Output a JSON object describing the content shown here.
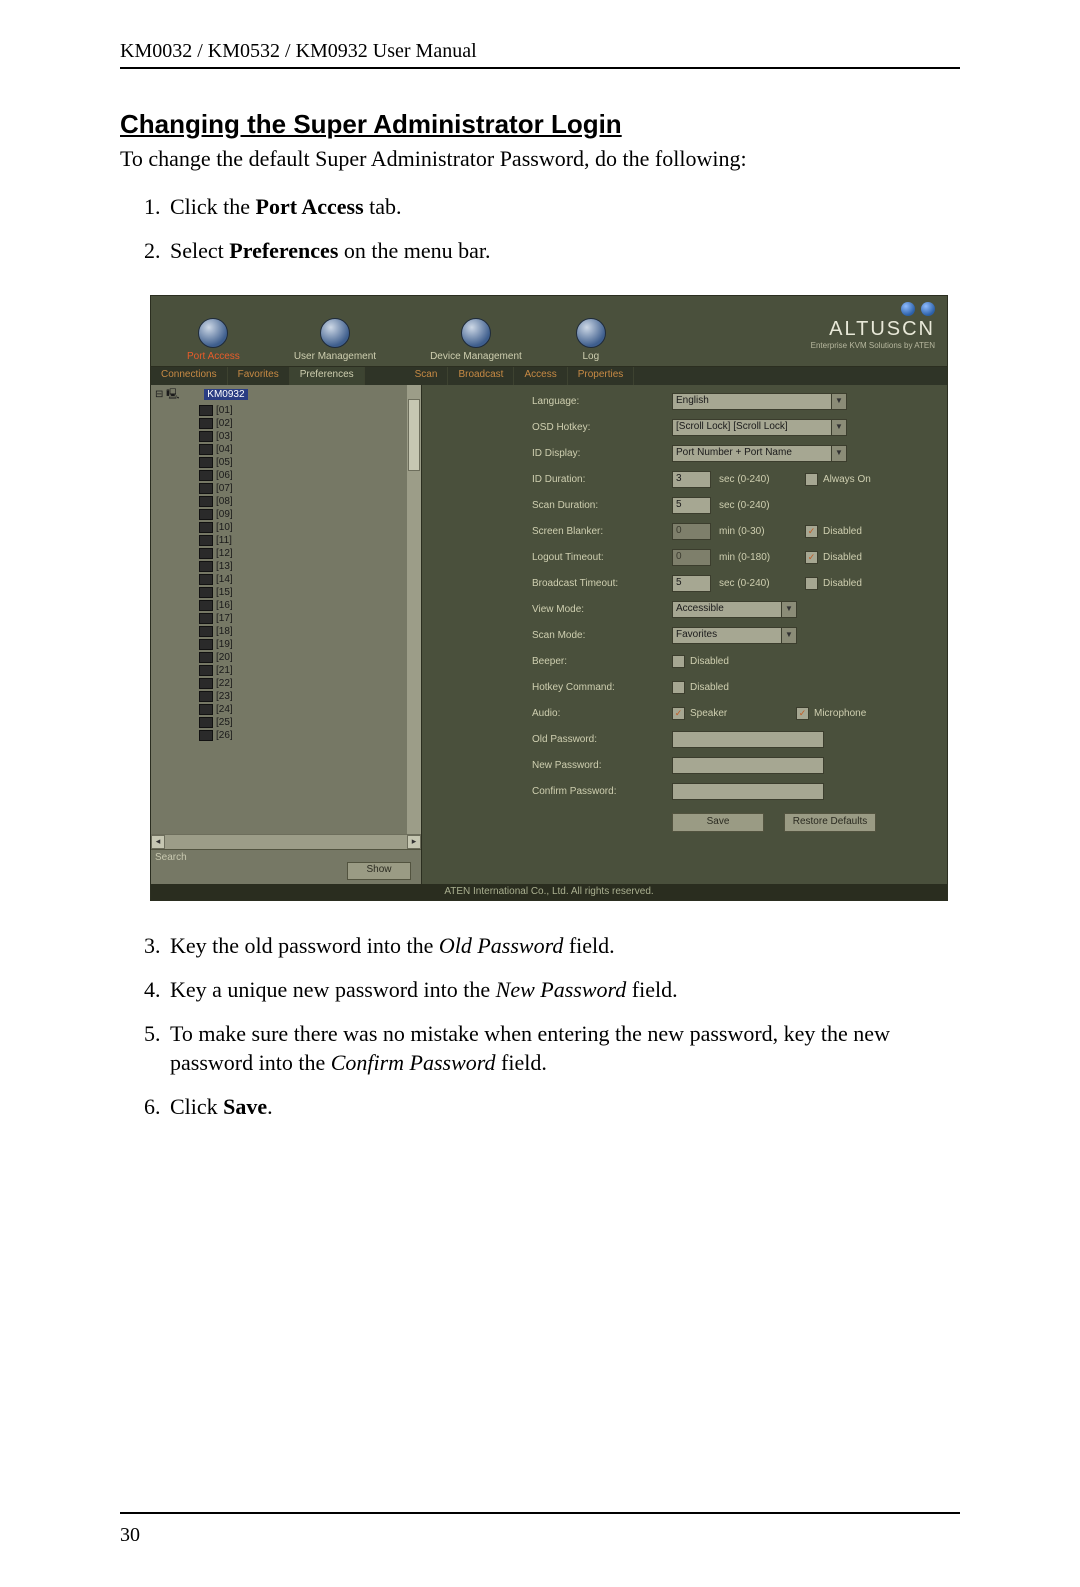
{
  "header": "KM0032 / KM0532 / KM0932 User Manual",
  "page_number": "30",
  "section_title": "Changing the Super Administrator Login",
  "intro": "To change the default Super Administrator Password, do the following:",
  "steps_a": [
    {
      "pre": "Click the ",
      "bold": "Port Access",
      "post": " tab."
    },
    {
      "pre": "Select ",
      "bold": "Preferences",
      "post": " on the menu bar."
    }
  ],
  "steps_b": [
    {
      "pre": "Key the old password into the ",
      "italic": "Old Password",
      "post": " field."
    },
    {
      "pre": "Key a unique new password into the ",
      "italic": "New Password",
      "post": " field."
    },
    {
      "pre": "To make sure there was no mistake when entering the new password, key the new password into the ",
      "italic": "Confirm Password",
      "post": " field."
    },
    {
      "pre": "Click ",
      "bold": "Save",
      "post": "."
    }
  ],
  "shot": {
    "nav": [
      "Port Access",
      "User Management",
      "Device Management",
      "Log"
    ],
    "brand": {
      "logo": "ALTUSCN",
      "sub": "Enterprise KVM Solutions by ATEN"
    },
    "tabs_left": [
      "Connections",
      "Favorites",
      "Preferences"
    ],
    "tabs_right": [
      "Scan",
      "Broadcast",
      "Access",
      "Properties"
    ],
    "tree_root": "KM0932",
    "ports": [
      "[01]",
      "[02]",
      "[03]",
      "[04]",
      "[05]",
      "[06]",
      "[07]",
      "[08]",
      "[09]",
      "[10]",
      "[11]",
      "[12]",
      "[13]",
      "[14]",
      "[15]",
      "[16]",
      "[17]",
      "[18]",
      "[19]",
      "[20]",
      "[21]",
      "[22]",
      "[23]",
      "[24]",
      "[25]",
      "[26]"
    ],
    "search_label": "Search",
    "show_btn": "Show",
    "settings": {
      "language": {
        "label": "Language:",
        "value": "English"
      },
      "hotkey": {
        "label": "OSD Hotkey:",
        "value": "[Scroll Lock] [Scroll Lock]"
      },
      "iddisplay": {
        "label": "ID Display:",
        "value": "Port Number + Port Name"
      },
      "idduration": {
        "label": "ID Duration:",
        "value": "3",
        "unit": "sec (0-240)",
        "chk": "Always On"
      },
      "scanduration": {
        "label": "Scan Duration:",
        "value": "5",
        "unit": "sec (0-240)"
      },
      "blanker": {
        "label": "Screen Blanker:",
        "value": "0",
        "unit": "min (0-30)",
        "chk": "Disabled"
      },
      "logout": {
        "label": "Logout Timeout:",
        "value": "0",
        "unit": "min (0-180)",
        "chk": "Disabled"
      },
      "broadcast": {
        "label": "Broadcast Timeout:",
        "value": "5",
        "unit": "sec (0-240)",
        "chk": "Disabled"
      },
      "viewmode": {
        "label": "View Mode:",
        "value": "Accessible"
      },
      "scanmode": {
        "label": "Scan Mode:",
        "value": "Favorites"
      },
      "beeper": {
        "label": "Beeper:",
        "chk": "Disabled"
      },
      "hotcmd": {
        "label": "Hotkey Command:",
        "chk": "Disabled"
      },
      "audio": {
        "label": "Audio:",
        "chk1": "Speaker",
        "chk2": "Microphone"
      },
      "oldpw": {
        "label": "Old Password:"
      },
      "newpw": {
        "label": "New Password:"
      },
      "confpw": {
        "label": "Confirm Password:"
      }
    },
    "save_btn": "Save",
    "restore_btn": "Restore Defaults",
    "footer": "ATEN International Co., Ltd. All rights reserved."
  }
}
